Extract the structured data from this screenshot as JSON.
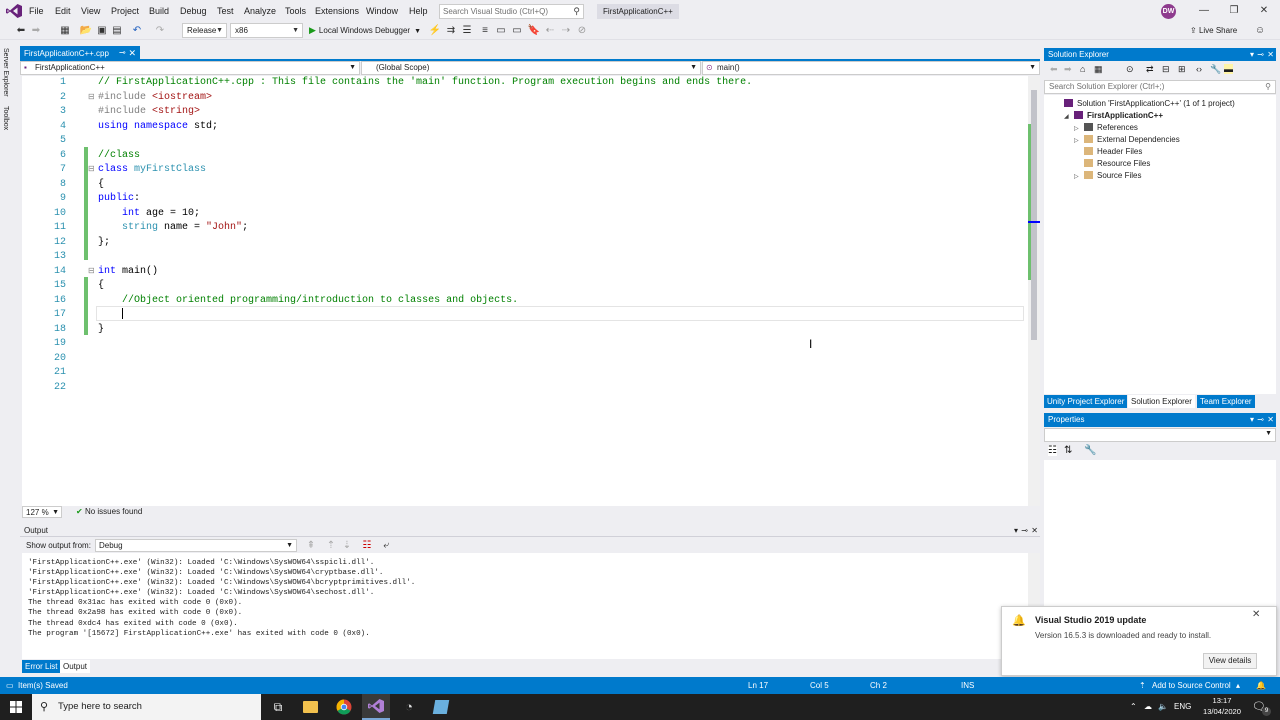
{
  "menu": [
    "File",
    "Edit",
    "View",
    "Project",
    "Build",
    "Debug",
    "Test",
    "Analyze",
    "Tools",
    "Extensions",
    "Window",
    "Help"
  ],
  "search_placeholder": "Search Visual Studio (Ctrl+Q)",
  "project_title": "FirstApplicationC++",
  "user_initials": "DW",
  "toolbar": {
    "config": "Release",
    "platform": "x86",
    "run_label": "Local Windows Debugger",
    "live_share": "Live Share"
  },
  "left_tabs": [
    "Server Explorer",
    "Toolbox"
  ],
  "doc_tab": "FirstApplicationC++.cpp",
  "navbar": {
    "project": "FirstApplicationC++",
    "scope": "(Global Scope)",
    "member": "main()"
  },
  "code_lines": [
    {
      "n": "1",
      "html": "<span class=\"cm\">// FirstApplicationC++.cpp : This file contains the 'main' function. Program execution begins and ends there.</span>"
    },
    {
      "n": "2",
      "html": "<span class=\"pp\">#include</span> <span class=\"str\">&lt;iostream&gt;</span>"
    },
    {
      "n": "3",
      "html": "<span class=\"pp\">#include</span> <span class=\"str\">&lt;string&gt;</span>"
    },
    {
      "n": "4",
      "html": "<span class=\"kw\">using namespace</span> std;"
    },
    {
      "n": "5",
      "html": ""
    },
    {
      "n": "6",
      "html": "<span class=\"cm\">//class</span>"
    },
    {
      "n": "7",
      "html": "<span class=\"kw\">class</span> <span class=\"ty\">myFirstClass</span>"
    },
    {
      "n": "8",
      "html": "{"
    },
    {
      "n": "9",
      "html": "<span class=\"kw\">public</span>:"
    },
    {
      "n": "10",
      "html": "    <span class=\"kw\">int</span> age = 10;"
    },
    {
      "n": "11",
      "html": "    <span class=\"ty\">string</span> name = <span class=\"str\">\"John\"</span>;"
    },
    {
      "n": "12",
      "html": "};"
    },
    {
      "n": "13",
      "html": ""
    },
    {
      "n": "14",
      "html": "<span class=\"kw\">int</span> main()"
    },
    {
      "n": "15",
      "html": "{"
    },
    {
      "n": "16",
      "html": "    <span class=\"cm\">//Object oriented programming/introduction to classes and objects.</span>"
    },
    {
      "n": "17",
      "html": ""
    },
    {
      "n": "18",
      "html": "}"
    },
    {
      "n": "19",
      "html": ""
    },
    {
      "n": "20",
      "html": ""
    },
    {
      "n": "21",
      "html": ""
    },
    {
      "n": "22",
      "html": ""
    }
  ],
  "editor_status": {
    "zoom": "127 %",
    "issues": "No issues found"
  },
  "output": {
    "title": "Output",
    "show_from_label": "Show output from:",
    "source": "Debug",
    "lines": [
      "'FirstApplicationC++.exe' (Win32): Loaded 'C:\\Windows\\SysWOW64\\sspicli.dll'.",
      "'FirstApplicationC++.exe' (Win32): Loaded 'C:\\Windows\\SysWOW64\\cryptbase.dll'.",
      "'FirstApplicationC++.exe' (Win32): Loaded 'C:\\Windows\\SysWOW64\\bcryptprimitives.dll'.",
      "'FirstApplicationC++.exe' (Win32): Loaded 'C:\\Windows\\SysWOW64\\sechost.dll'.",
      "The thread 0x31ac has exited with code 0 (0x0).",
      "The thread 0x2a98 has exited with code 0 (0x0).",
      "The thread 0xdc4 has exited with code 0 (0x0).",
      "The program '[15672] FirstApplicationC++.exe' has exited with code 0 (0x0)."
    ]
  },
  "bottom_tabs": [
    "Error List",
    "Output"
  ],
  "solution_explorer": {
    "title": "Solution Explorer",
    "search_placeholder": "Search Solution Explorer (Ctrl+;)",
    "tree": [
      {
        "label": "Solution 'FirstApplicationC++' (1 of 1 project)",
        "indent": 0,
        "arrow": "",
        "icon": "solution"
      },
      {
        "label": "FirstApplicationC++",
        "indent": 1,
        "arrow": "◢",
        "icon": "project",
        "bold": true
      },
      {
        "label": "References",
        "indent": 2,
        "arrow": "▷",
        "icon": "references"
      },
      {
        "label": "External Dependencies",
        "indent": 2,
        "arrow": "▷",
        "icon": "folder"
      },
      {
        "label": "Header Files",
        "indent": 2,
        "arrow": "",
        "icon": "folder"
      },
      {
        "label": "Resource Files",
        "indent": 2,
        "arrow": "",
        "icon": "folder"
      },
      {
        "label": "Source Files",
        "indent": 2,
        "arrow": "▷",
        "icon": "folder"
      }
    ],
    "tabs": [
      "Unity Project Explorer",
      "Solution Explorer",
      "Team Explorer"
    ]
  },
  "properties_title": "Properties",
  "toast": {
    "title": "Visual Studio 2019 update",
    "text": "Version 16.5.3 is downloaded and ready to install.",
    "button": "View details"
  },
  "statusbar": {
    "left": "Item(s) Saved",
    "ln": "Ln 17",
    "col": "Col 5",
    "ch": "Ch 2",
    "ins": "INS",
    "source_control": "Add to Source Control"
  },
  "taskbar": {
    "search_placeholder": "Type here to search",
    "lang": "ENG",
    "time": "13:17",
    "date": "13/04/2020",
    "notif_count": "9"
  },
  "colors": {
    "accent": "#007acc",
    "vs_purple": "#68217a",
    "comment": "#008000",
    "keyword": "#0000ff",
    "type": "#2b91af",
    "string": "#a31515"
  }
}
